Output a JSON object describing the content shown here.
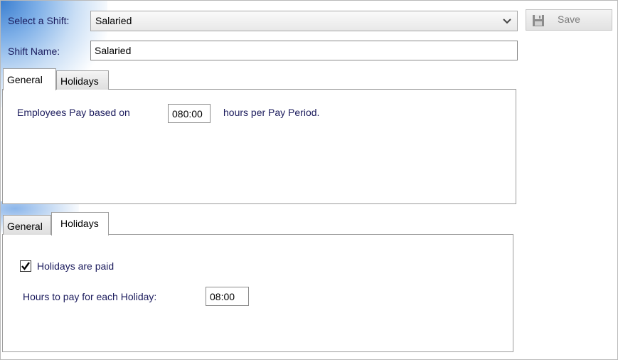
{
  "header": {
    "select_shift_label": "Select a Shift:",
    "selected_shift": "Salaried",
    "shift_name_label": "Shift Name:",
    "shift_name_value": "Salaried",
    "save_label": "Save"
  },
  "top_tabs": [
    {
      "label": "General",
      "active": true
    },
    {
      "label": "Holidays",
      "active": false
    }
  ],
  "general_panel": {
    "pay_prefix": "Employees Pay based on",
    "pay_hours": "080:00",
    "pay_suffix": "hours per Pay Period."
  },
  "bottom_tabs": [
    {
      "label": "General",
      "active": false
    },
    {
      "label": "Holidays",
      "active": true
    }
  ],
  "holidays_panel": {
    "paid_label": "Holidays are paid",
    "paid_checked": true,
    "hours_label": "Hours to pay for each Holiday:",
    "hours_value": "08:00"
  },
  "icons": {
    "save": "floppy-disk-icon",
    "dropdown": "chevron-down-icon",
    "check": "checkmark-icon"
  }
}
